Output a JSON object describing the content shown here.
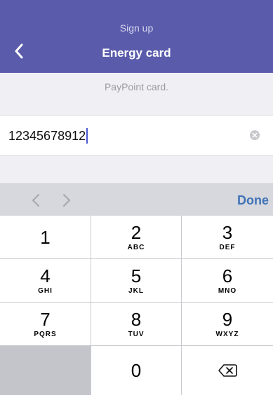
{
  "header": {
    "subtitle": "Sign up",
    "title": "Energy card",
    "back_icon": "chevron-left-icon",
    "background": "#5a5bab"
  },
  "info": {
    "line": "PayPoint card."
  },
  "field": {
    "value": "12345678912",
    "clear_icon": "clear-circle-icon"
  },
  "toolbar": {
    "prev_icon": "chevron-left-icon",
    "next_icon": "chevron-right-icon",
    "done_label": "Done",
    "accent": "#3f72b8"
  },
  "keypad": {
    "keys": [
      {
        "num": "1",
        "letters": ""
      },
      {
        "num": "2",
        "letters": "ABC"
      },
      {
        "num": "3",
        "letters": "DEF"
      },
      {
        "num": "4",
        "letters": "GHI"
      },
      {
        "num": "5",
        "letters": "JKL"
      },
      {
        "num": "6",
        "letters": "MNO"
      },
      {
        "num": "7",
        "letters": "PQRS"
      },
      {
        "num": "8",
        "letters": "TUV"
      },
      {
        "num": "9",
        "letters": "WXYZ"
      },
      {
        "num": "0",
        "letters": ""
      }
    ],
    "delete_icon": "backspace-icon"
  }
}
